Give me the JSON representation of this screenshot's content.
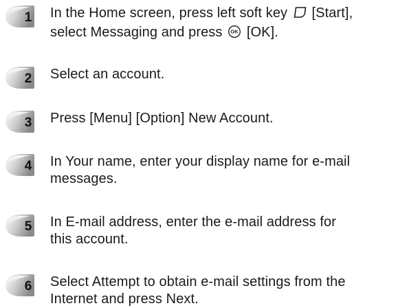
{
  "steps": [
    {
      "number": "1",
      "line1_a": "In the Home screen, press left soft key",
      "icon1": "left-soft-key-icon",
      "line1_b": "[Start],",
      "line2_a": "select Messaging and press",
      "icon2": "ok-key-icon",
      "icon2_text": "OK",
      "line2_b": "[OK]."
    },
    {
      "number": "2",
      "line1": "Select an account."
    },
    {
      "number": "3",
      "line1": "Press [Menu] [Option] New Account."
    },
    {
      "number": "4",
      "line1": "In Your name, enter your display name for e-mail",
      "line2": "messages."
    },
    {
      "number": "5",
      "line1": "In E-mail address, enter the e-mail address for",
      "line2": "this account."
    },
    {
      "number": "6",
      "line1": "Select Attempt to obtain e-mail settings from the",
      "line2": "Internet and press Next."
    }
  ],
  "colors": {
    "badge_light": "#f4f4f4",
    "badge_dark": "#8c8c8c",
    "text": "#1a1a1a"
  }
}
